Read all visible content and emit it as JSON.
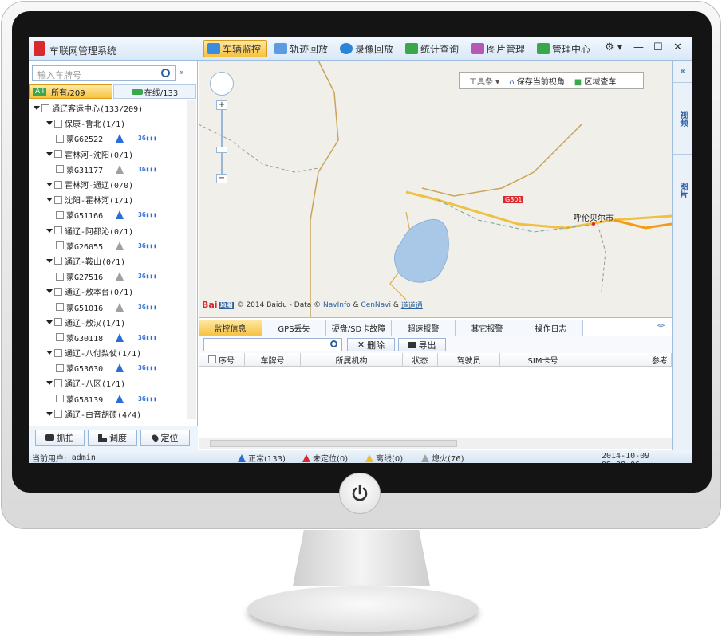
{
  "app": {
    "title": "车联网管理系统"
  },
  "main_tabs": [
    {
      "label": "车辆监控",
      "active": true,
      "icon": "send-icon"
    },
    {
      "label": "轨迹回放",
      "icon": "track-icon"
    },
    {
      "label": "录像回放",
      "icon": "play-icon"
    },
    {
      "label": "统计查询",
      "icon": "chart-icon"
    },
    {
      "label": "图片管理",
      "icon": "picture-icon"
    },
    {
      "label": "管理中心",
      "icon": "monitor-icon"
    }
  ],
  "window_controls": {
    "settings": "⚙ ▾",
    "minimize": "—",
    "maximize": "☐",
    "close": "✕"
  },
  "left": {
    "search_placeholder": "输入车牌号",
    "collapse": "«",
    "filter_all_badge": "All",
    "filter_all": "所有/209",
    "filter_online": "在线/133",
    "tree": [
      {
        "type": "root",
        "label": "通辽客运中心(133/209)"
      },
      {
        "type": "group",
        "label": "保康-鲁北(1/1)"
      },
      {
        "type": "vehicle",
        "label": "蒙G62522",
        "status": "blue"
      },
      {
        "type": "group",
        "label": "霍林河-沈阳(0/1)"
      },
      {
        "type": "vehicle",
        "label": "蒙G31177",
        "status": "gray"
      },
      {
        "type": "group",
        "label": "霍林河-通辽(0/0)"
      },
      {
        "type": "group",
        "label": "沈阳-霍林河(1/1)"
      },
      {
        "type": "vehicle",
        "label": "蒙G51166",
        "status": "blue"
      },
      {
        "type": "group",
        "label": "通辽-阿都沁(0/1)"
      },
      {
        "type": "vehicle",
        "label": "蒙G26055",
        "status": "gray"
      },
      {
        "type": "group",
        "label": "通辽-鞍山(0/1)"
      },
      {
        "type": "vehicle",
        "label": "蒙G27516",
        "status": "gray"
      },
      {
        "type": "group",
        "label": "通辽-敖本台(0/1)"
      },
      {
        "type": "vehicle",
        "label": "蒙G51016",
        "status": "gray"
      },
      {
        "type": "group",
        "label": "通辽-敖汉(1/1)"
      },
      {
        "type": "vehicle",
        "label": "蒙G30118",
        "status": "blue"
      },
      {
        "type": "group",
        "label": "通辽-八付梨仗(1/1)"
      },
      {
        "type": "vehicle",
        "label": "蒙G53630",
        "status": "blue"
      },
      {
        "type": "group",
        "label": "通辽-八区(1/1)"
      },
      {
        "type": "vehicle",
        "label": "蒙G58139",
        "status": "blue"
      },
      {
        "type": "group",
        "label": "通辽-白音胡硕(4/4)"
      }
    ],
    "buttons": {
      "capture": "抓拍",
      "dispatch": "调度",
      "locate": "定位"
    }
  },
  "map": {
    "toolbar": "工具条 ▾",
    "save_view": "保存当前视角",
    "area_search": "区域查车",
    "road_label": "G301",
    "city_label": "呼伦贝尔市",
    "copyright": "© 2014 Baidu - Data ©",
    "navinfo": "NavInfo",
    "amp": "&",
    "cennavi": "CenNavi",
    "daotong": "道道通",
    "baidu_logo": "Bai",
    "baidu_logo2": "地图"
  },
  "right_tabs": [
    "视频",
    "图片"
  ],
  "right_collapse": "«",
  "bottom": {
    "tabs": [
      "监控信息",
      "GPS丢失",
      "硬盘/SD卡故障",
      "超速报警",
      "其它报警",
      "操作日志"
    ],
    "expand": "︾",
    "delete": "删除",
    "export": "导出",
    "columns": [
      "序号",
      "车牌号",
      "所属机构",
      "状态",
      "驾驶员",
      "SIM卡号",
      "参考"
    ]
  },
  "status": {
    "user_label": "当前用户:",
    "user": "admin",
    "normal": "正常(133)",
    "unlocated": "未定位(0)",
    "offline": "离线(0)",
    "off": "熄火(76)",
    "datetime": "2014-10-09 09:08:06"
  }
}
